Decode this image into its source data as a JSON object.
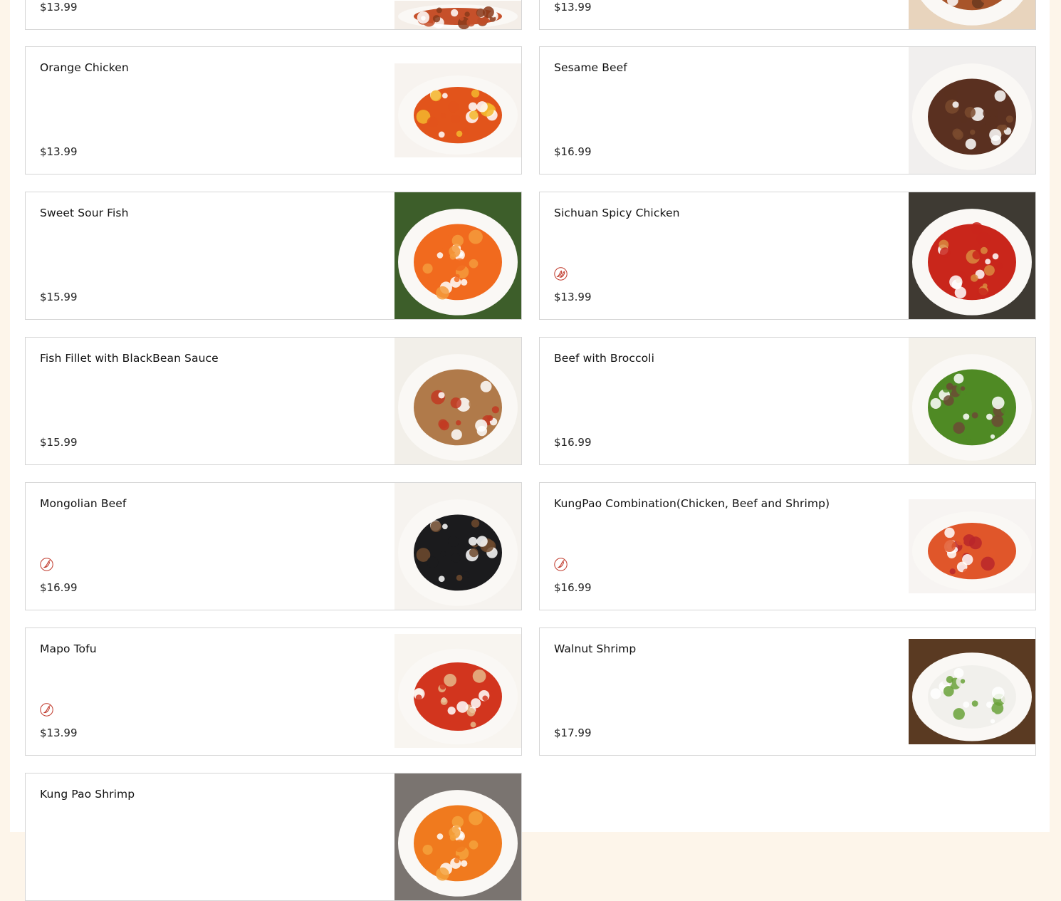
{
  "menu_items": [
    {
      "name": "",
      "price": "$13.99",
      "spicy": false,
      "image": "dish-photo",
      "colors": [
        "#c6502a",
        "#f4eee8",
        "#8a3a1a"
      ]
    },
    {
      "name": "",
      "price": "$13.99",
      "spicy": false,
      "image": "dish-photo",
      "colors": [
        "#a8552a",
        "#e8d4bd",
        "#6b3a1e"
      ]
    },
    {
      "name": "Orange Chicken",
      "price": "$13.99",
      "spicy": false,
      "image": "orange-chicken-photo",
      "colors": [
        "#e2541b",
        "#f7f3ef",
        "#f3b72d"
      ]
    },
    {
      "name": "Sesame Beef",
      "price": "$16.99",
      "spicy": false,
      "image": "sesame-beef-photo",
      "colors": [
        "#5a3020",
        "#f1efee",
        "#7a4a2e"
      ]
    },
    {
      "name": "Sweet Sour Fish",
      "price": "$15.99",
      "spicy": false,
      "image": "sweet-sour-fish-photo",
      "colors": [
        "#f16a1e",
        "#3d5e2a",
        "#f59a3c"
      ]
    },
    {
      "name": "Sichuan Spicy Chicken",
      "price": "$13.99",
      "spicy": true,
      "spicy_level": 2,
      "image": "sichuan-spicy-chicken-photo",
      "colors": [
        "#c9261b",
        "#3e3a33",
        "#d98a3e"
      ]
    },
    {
      "name": "Fish Fillet with BlackBean Sauce",
      "price": "$15.99",
      "spicy": false,
      "image": "fish-fillet-photo",
      "colors": [
        "#b07a4a",
        "#f2efe9",
        "#c23a22"
      ]
    },
    {
      "name": "Beef with Broccoli",
      "price": "$16.99",
      "spicy": false,
      "image": "beef-broccoli-photo",
      "colors": [
        "#4f8a24",
        "#f4f1ea",
        "#6b4a35"
      ]
    },
    {
      "name": "Mongolian Beef",
      "price": "$16.99",
      "spicy": true,
      "spicy_level": 1,
      "image": "mongolian-beef-photo",
      "colors": [
        "#1b1b1d",
        "#f6f3ef",
        "#6e4a2e"
      ]
    },
    {
      "name": "KungPao Combination(Chicken, Beef and Shrimp)",
      "price": "$16.99",
      "spicy": true,
      "spicy_level": 1,
      "image": "kungpao-combination-photo",
      "colors": [
        "#e0562a",
        "#f7f4f2",
        "#b8262a"
      ]
    },
    {
      "name": "Mapo Tofu",
      "price": "$13.99",
      "spicy": true,
      "spicy_level": 1,
      "image": "mapo-tofu-photo",
      "colors": [
        "#d2351e",
        "#f8f5f0",
        "#e6b88a"
      ]
    },
    {
      "name": "Walnut Shrimp",
      "price": "$17.99",
      "spicy": false,
      "image": "walnut-shrimp-photo",
      "colors": [
        "#f1f0ec",
        "#5a3a22",
        "#6aa23a"
      ]
    },
    {
      "name": "Kung Pao Shrimp",
      "price": "",
      "spicy": false,
      "image": "kung-pao-shrimp-photo",
      "colors": [
        "#f07a1e",
        "#7a7470",
        "#f5a23c"
      ]
    }
  ],
  "spicy_icon_color": "#c0392b"
}
